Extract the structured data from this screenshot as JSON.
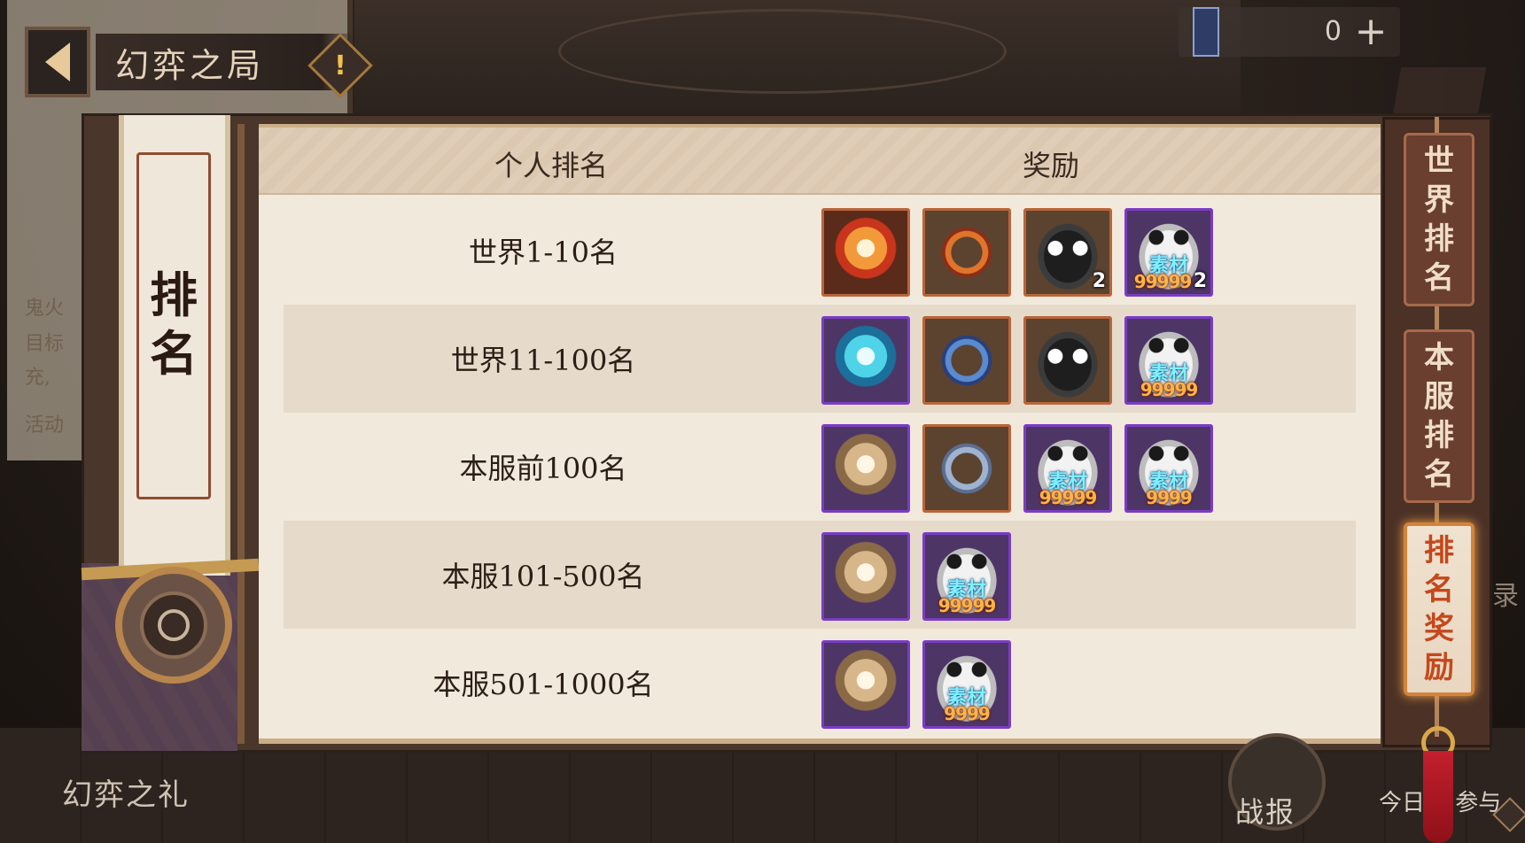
{
  "header": {
    "title": "幻弈之局",
    "info_symbol": "!",
    "currency_value": "0",
    "currency_plus": "+"
  },
  "left_banner": {
    "title": "排名"
  },
  "table": {
    "col_rank": "个人排名",
    "col_reward": "奖励",
    "rows": [
      {
        "label": "世界1-10名",
        "rewards": [
          {
            "icon": "fire-crest-icon",
            "frame": "orange"
          },
          {
            "icon": "fire-ring-frame-icon",
            "frame": "orange"
          },
          {
            "icon": "daruma-black-icon",
            "frame": "orange",
            "qty": "2"
          },
          {
            "icon": "daruma-white-material-icon",
            "frame": "purple",
            "label": "素材",
            "num": "99999",
            "qty": "2"
          }
        ]
      },
      {
        "label": "世界11-100名",
        "rewards": [
          {
            "icon": "peacock-crest-icon",
            "frame": "purple"
          },
          {
            "icon": "blue-ring-frame-icon",
            "frame": "orange"
          },
          {
            "icon": "daruma-black-icon",
            "frame": "orange"
          },
          {
            "icon": "daruma-white-material-icon",
            "frame": "purple",
            "label": "素材",
            "num": "99999"
          }
        ]
      },
      {
        "label": "本服前100名",
        "rewards": [
          {
            "icon": "gold-crest-icon",
            "frame": "purple"
          },
          {
            "icon": "silver-ring-frame-icon",
            "frame": "orange"
          },
          {
            "icon": "daruma-white-material-icon",
            "frame": "purple",
            "label": "素材",
            "num": "99999"
          },
          {
            "icon": "daruma-white-material-icon",
            "frame": "purple",
            "label": "素材",
            "num": "9999"
          }
        ]
      },
      {
        "label": "本服101-500名",
        "rewards": [
          {
            "icon": "gold-crest-icon",
            "frame": "purple"
          },
          {
            "icon": "daruma-white-material-icon",
            "frame": "purple",
            "label": "素材",
            "num": "99999"
          }
        ]
      },
      {
        "label": "本服501-1000名",
        "rewards": [
          {
            "icon": "gold-crest-icon",
            "frame": "purple"
          },
          {
            "icon": "daruma-white-material-icon",
            "frame": "purple",
            "label": "素材",
            "num": "9999"
          }
        ]
      }
    ]
  },
  "tabs": [
    {
      "label": "世界排名",
      "active": false
    },
    {
      "label": "本服排名",
      "active": false
    },
    {
      "label": "排名奖励",
      "active": true
    }
  ],
  "background": {
    "side_text_1": "鬼火",
    "side_text_2": "目标",
    "side_text_3": "充,",
    "side_text_4": "活动",
    "bottom_left_label": "幻弈之礼",
    "battle_report_label": "战报",
    "today_label": "今日",
    "today_suffix": "参与",
    "right_edge_char": "录",
    "top_right_tab": "排名"
  },
  "colors": {
    "accent_active": "#c4481c",
    "frame_orange": "#b9653a",
    "frame_purple": "#7b3cc4",
    "material_label": "#7ff0ff",
    "material_number": "#ffb347"
  }
}
